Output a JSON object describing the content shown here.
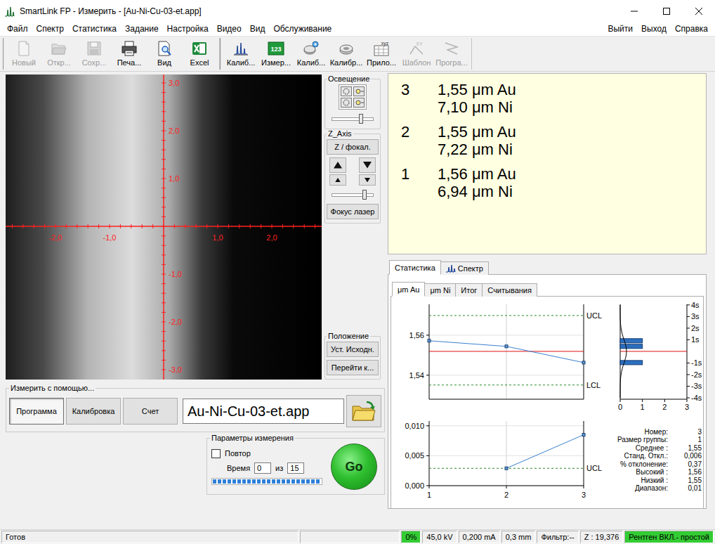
{
  "window": {
    "title": "SmartLink FP - Измерить - [Au-Ni-Cu-03-et.app]"
  },
  "menu": {
    "left": [
      "Файл",
      "Спектр",
      "Статистика",
      "Задание",
      "Настройка",
      "Видео",
      "Вид",
      "Обслуживание"
    ],
    "right": [
      "Выйти",
      "Выход",
      "Справка"
    ]
  },
  "toolbar": [
    {
      "items": [
        {
          "label": "Новый",
          "disabled": true
        },
        {
          "label": "Откр...",
          "disabled": true
        },
        {
          "label": "Сохр...",
          "disabled": true
        },
        {
          "label": "Печа...",
          "disabled": false
        },
        {
          "label": "Вид",
          "disabled": false
        },
        {
          "label": "Excel",
          "disabled": false
        }
      ]
    },
    {
      "items": [
        {
          "label": "Калиб...",
          "disabled": false
        },
        {
          "label": "Измер...",
          "disabled": false,
          "badge": "123"
        },
        {
          "label": "Калиб...",
          "disabled": false
        },
        {
          "label": "Калибр...",
          "disabled": false
        },
        {
          "label": "Прило...",
          "disabled": false,
          "badge": "xyz"
        },
        {
          "label": "Шаблон",
          "disabled": true,
          "badge": "XY"
        },
        {
          "label": "Програ...",
          "disabled": true
        }
      ]
    }
  ],
  "video": {
    "x_labels": [
      "-2,0",
      "-1,0",
      "1,0",
      "2,0"
    ],
    "y_labels": [
      "3,0",
      "2,0",
      "1,0",
      "-1,0",
      "-2,0",
      "-3,0"
    ]
  },
  "lighting": {
    "title": "Освещение",
    "slider": {
      "level": 0.7
    }
  },
  "z_axis": {
    "title": "Z_Axis",
    "focus_button": "Z / фокал.",
    "slider": {
      "level": 0.8
    },
    "laser_button": "Фокус лазер"
  },
  "position": {
    "title": "Положение",
    "buttons": [
      "Уст. Исходн.",
      "Перейти к..."
    ]
  },
  "measure_with": {
    "title": "Измерить с помощью...",
    "modes": [
      {
        "label": "Программа",
        "selected": true
      },
      {
        "label": "Калибровка",
        "selected": false
      },
      {
        "label": "Счет",
        "selected": false
      }
    ],
    "file": "Au-Ni-Cu-03-et.app"
  },
  "params": {
    "title": "Параметры измерения",
    "repeat": {
      "label": "Повтор",
      "checked": false
    },
    "time_label": "Время",
    "time_value": "0",
    "of_label": "из",
    "of_value": "15",
    "progress": {
      "level": 1
    },
    "go": "Go"
  },
  "results": [
    {
      "index": "3",
      "lines": [
        "1,55 μm Au",
        "7,10 μm Ni"
      ]
    },
    {
      "index": "2",
      "lines": [
        "1,55 μm Au",
        "7,22 μm Ni"
      ]
    },
    {
      "index": "1",
      "lines": [
        "1,56 μm Au",
        "6,94 μm Ni"
      ]
    }
  ],
  "tabs": [
    {
      "label": "Статистика",
      "selected": true
    },
    {
      "label": "Спектр",
      "selected": false
    }
  ],
  "subtabs": [
    {
      "label": "μm Au",
      "selected": true
    },
    {
      "label": "μm Ni",
      "selected": false
    },
    {
      "label": "Итог",
      "selected": false
    },
    {
      "label": "Считывания",
      "selected": false
    }
  ],
  "control_chart": {
    "y_ticks": [
      "1,56",
      "1,54"
    ],
    "values": [
      1.5572,
      1.5544,
      1.5463
    ],
    "mean": 1.5519,
    "limits": [
      {
        "label": "UCL",
        "value": 1.5698
      },
      {
        "label": "LCL",
        "value": 1.5351
      }
    ]
  },
  "histogram": {
    "sigma": 0.0058,
    "sigma_ticks": [
      "4s",
      "3s",
      "2s",
      "1s",
      "-1s",
      "-2s",
      "-3s",
      "-4s"
    ],
    "x_ticks": [
      "0",
      "1",
      "2",
      "3"
    ],
    "bars": [
      {
        "value": 1.5572,
        "count": 1
      },
      {
        "value": 1.5544,
        "count": 1
      },
      {
        "value": 1.5463,
        "count": 1
      }
    ]
  },
  "range_chart": {
    "y_ticks": [
      "0,010",
      "0,005",
      "0,000"
    ],
    "x_ticks": [
      "1",
      "2",
      "3"
    ],
    "values": [
      null,
      0.0029,
      0.0085
    ],
    "limit": {
      "label": "UCL",
      "value": 0.0029
    }
  },
  "stats": [
    {
      "label": "Номер:",
      "value": "3"
    },
    {
      "label": "Размер группы:",
      "value": "1"
    },
    {
      "label": "Среднее :",
      "value": "1,55"
    },
    {
      "label": "Станд. Откл.:",
      "value": "0,006"
    },
    {
      "label": "% отклонение:",
      "value": "0,37"
    },
    {
      "label": "Высокий :",
      "value": "1,56"
    },
    {
      "label": "Низкий :",
      "value": "1,55"
    },
    {
      "label": "Диапазон:",
      "value": "0,01"
    }
  ],
  "status_bar": [
    {
      "text": "Готов",
      "color": "#f0f0f0"
    },
    {
      "text": "0%",
      "color": "#33cc33"
    },
    {
      "text": "45,0 kV",
      "color": "#f0f0f0"
    },
    {
      "text": "0,200 mA",
      "color": "#f0f0f0"
    },
    {
      "text": "0,3 mm",
      "color": "#f0f0f0"
    },
    {
      "text": "Фильтр:--",
      "color": "#f0f0f0"
    },
    {
      "text": "Z : 19,376",
      "color": "#f0f0f0"
    },
    {
      "text": "Рентген ВКЛ.- простой",
      "color": "#33cc33"
    }
  ]
}
